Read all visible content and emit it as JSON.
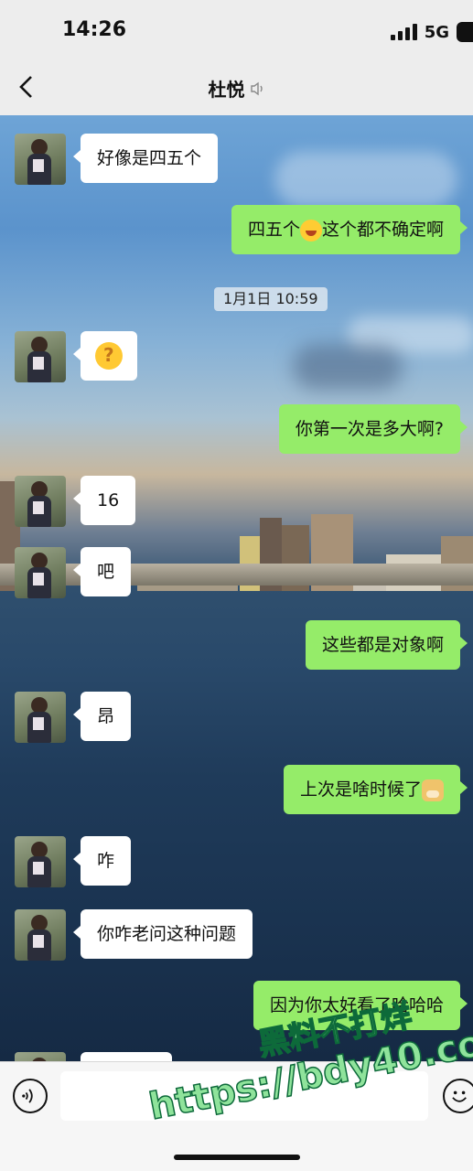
{
  "status": {
    "time": "14:26",
    "network": "5G"
  },
  "header": {
    "title": "杜悦"
  },
  "chat": {
    "time_divider": "1月1日 10:59",
    "messages": [
      {
        "side": "left",
        "text": "好像是四五个"
      },
      {
        "side": "right",
        "text_before": "四五个",
        "emoji": "laugh-cry-emoji",
        "text_after": "这个都不确定啊"
      },
      {
        "side": "left",
        "emoji": "question-emoji"
      },
      {
        "side": "right",
        "text": "你第一次是多大啊?"
      },
      {
        "side": "left",
        "text": "16"
      },
      {
        "side": "left",
        "text": "吧"
      },
      {
        "side": "right",
        "text": "这些都是对象啊"
      },
      {
        "side": "left",
        "text": "昂"
      },
      {
        "side": "right",
        "text": "上次是啥时候了",
        "emoji": "doge-emoji"
      },
      {
        "side": "left",
        "text": "咋"
      },
      {
        "side": "left",
        "text": "你咋老问这种问题"
      },
      {
        "side": "right",
        "text": "因为你太好看了哈哈哈"
      }
    ]
  },
  "input": {
    "placeholder": ""
  },
  "watermark": {
    "line1": "黑料不打烊",
    "line2": "https://bdy40.co"
  },
  "colors": {
    "bubble_sent": "#95ec69",
    "bubble_received": "#ffffff"
  }
}
